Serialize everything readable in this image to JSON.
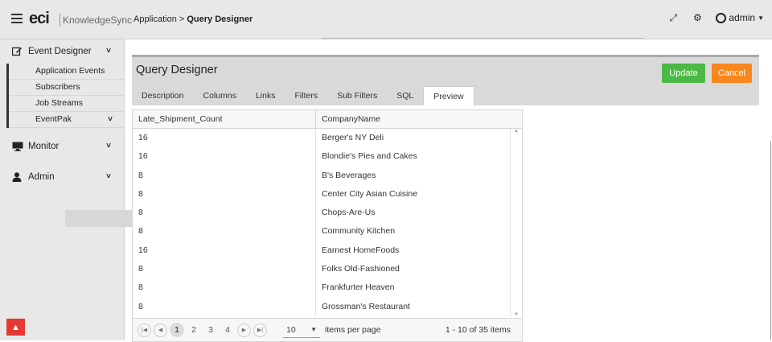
{
  "header": {
    "logo_main": "eci",
    "logo_product": "KnowledgeSync",
    "breadcrumb_prefix": "Application >",
    "breadcrumb_current": "Query Designer",
    "user_label": "admin"
  },
  "sidebar": {
    "sections": [
      {
        "label": "Event Designer",
        "icon": "edit-icon"
      },
      {
        "label": "Monitor",
        "icon": "monitor-icon"
      },
      {
        "label": "Admin",
        "icon": "user-icon"
      }
    ],
    "event_designer_items": [
      "Application Events",
      "Subscribers",
      "Job Streams",
      "EventPak"
    ]
  },
  "panel": {
    "title": "Query Designer",
    "update_label": "Update",
    "cancel_label": "Cancel",
    "tabs": [
      "Description",
      "Columns",
      "Links",
      "Filters",
      "Sub Filters",
      "SQL",
      "Preview"
    ],
    "active_tab": "Preview"
  },
  "grid": {
    "columns": [
      "Late_Shipment_Count",
      "CompanyName"
    ],
    "rows": [
      [
        "16",
        "Berger's NY Deli"
      ],
      [
        "16",
        "Blondie's Pies and Cakes"
      ],
      [
        "8",
        "B's Beverages"
      ],
      [
        "8",
        "Center City Asian Cuisine"
      ],
      [
        "8",
        "Chops-Are-Us"
      ],
      [
        "8",
        "Community Kitchen"
      ],
      [
        "16",
        "Earnest HomeFoods"
      ],
      [
        "8",
        "Folks Old-Fashioned"
      ],
      [
        "8",
        "Frankfurter Heaven"
      ],
      [
        "8",
        "Grossman's Restaurant"
      ]
    ],
    "pager": {
      "pages": [
        "1",
        "2",
        "3",
        "4"
      ],
      "current_page": "1",
      "page_size": "10",
      "page_size_label": "items per page",
      "info": "1 - 10 of 35 items"
    }
  },
  "colors": {
    "update": "#4cb944",
    "cancel": "#f7871e",
    "back_to_top": "#e53935"
  }
}
